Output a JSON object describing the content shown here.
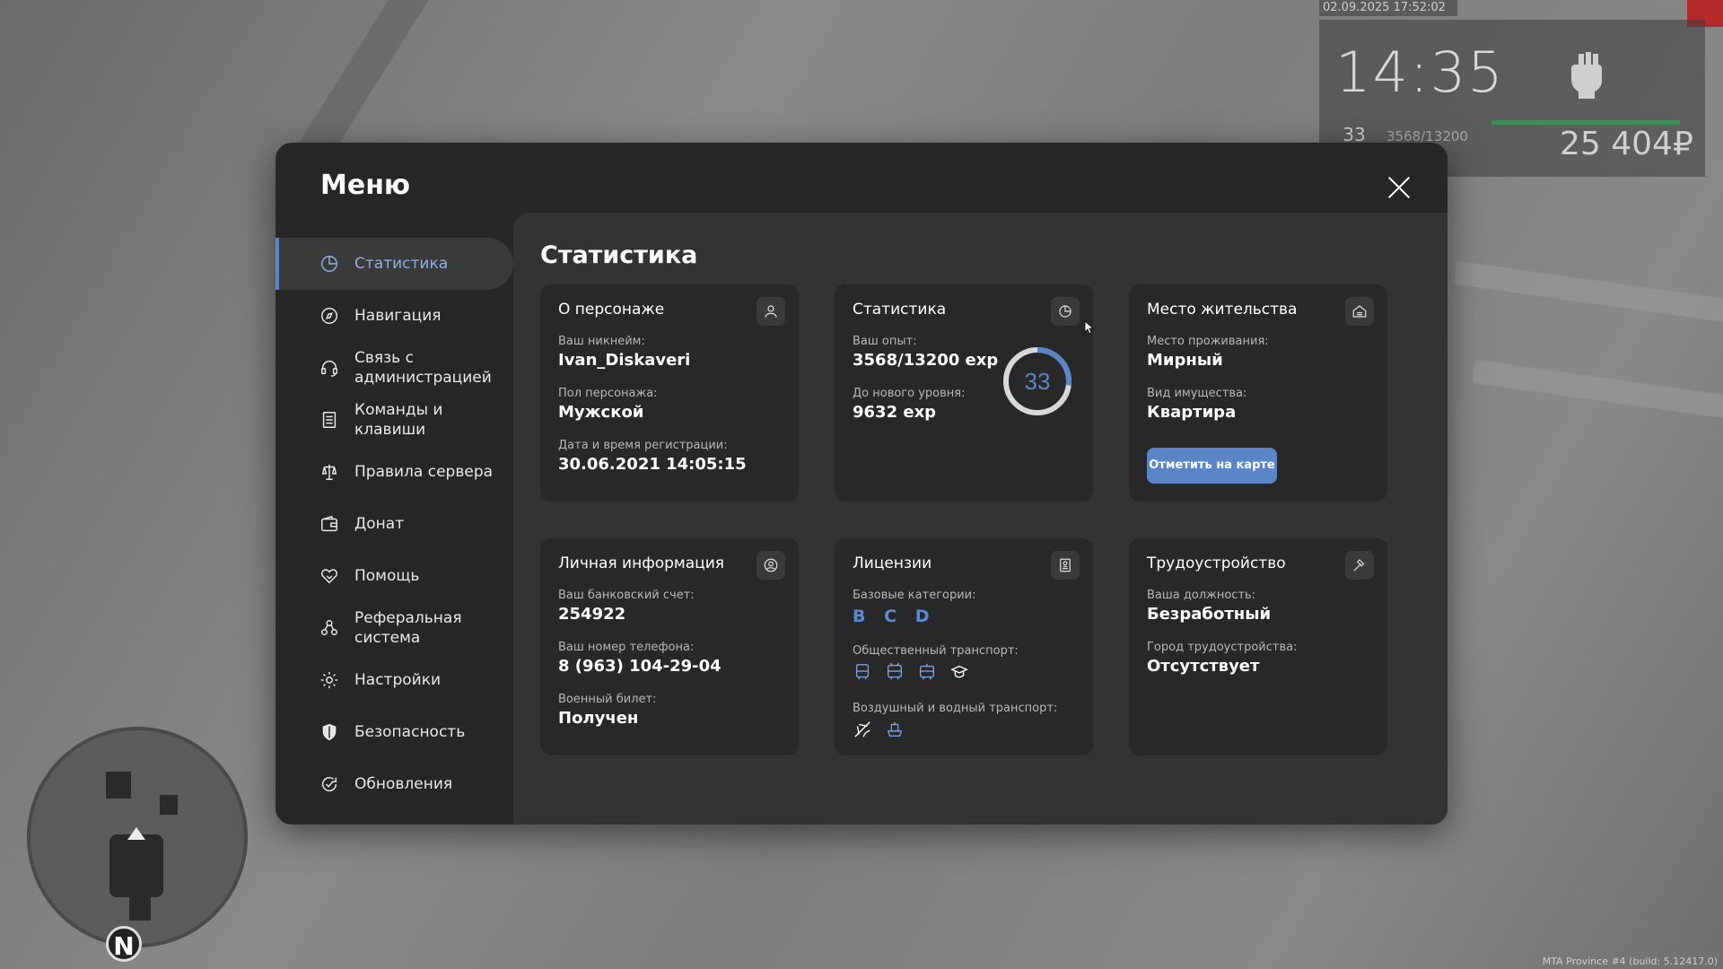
{
  "hud": {
    "datetime": "02.09.2025 17:52:02",
    "time": "14:35",
    "level": "33",
    "exp": "3568/13200",
    "money": "25 404₽"
  },
  "watermark": "MTA Province #4 (build: 5.12417.0)",
  "minimap": {
    "north": "N"
  },
  "menu": {
    "title": "Меню",
    "sidebar": [
      {
        "label": "Статистика",
        "icon": "pie-chart-icon",
        "active": true
      },
      {
        "label": "Навигация",
        "icon": "compass-icon"
      },
      {
        "label": "Связь с администрацией",
        "icon": "headset-icon"
      },
      {
        "label": "Команды и клавиши",
        "icon": "document-icon"
      },
      {
        "label": "Правила сервера",
        "icon": "scales-icon"
      },
      {
        "label": "Донат",
        "icon": "wallet-icon"
      },
      {
        "label": "Помощь",
        "icon": "handshake-icon"
      },
      {
        "label": "Реферальная система",
        "icon": "people-network-icon"
      },
      {
        "label": "Настройки",
        "icon": "gear-icon"
      },
      {
        "label": "Безопасность",
        "icon": "shield-icon"
      },
      {
        "label": "Обновления",
        "icon": "refresh-check-icon"
      }
    ]
  },
  "stats": {
    "title": "Статистика",
    "character": {
      "title": "О персонаже",
      "nick_label": "Ваш никнейм:",
      "nick": "Ivan_Diskaveri",
      "gender_label": "Пол персонажа:",
      "gender": "Мужской",
      "reg_label": "Дата и время регистрации:",
      "reg": "30.06.2021 14:05:15"
    },
    "statistics": {
      "title": "Статистика",
      "exp_label": "Ваш опыт:",
      "exp": "3568/13200 exp",
      "next_label": "До нового уровня:",
      "next": "9632 exp",
      "level": "33",
      "progress": 0.27
    },
    "residence": {
      "title": "Место жительства",
      "place_label": "Место проживания:",
      "place": "Мирный",
      "type_label": "Вид имущества:",
      "type": "Квартира",
      "button": "Отметить на карте"
    },
    "personal": {
      "title": "Личная информация",
      "bank_label": "Ваш банковский счет:",
      "bank": "254922",
      "phone_label": "Ваш номер телефона:",
      "phone": "8 (963) 104-29-04",
      "military_label": "Военный билет:",
      "military": "Получен"
    },
    "licenses": {
      "title": "Лицензии",
      "basic_label": "Базовые категории:",
      "categories": [
        "B",
        "C",
        "D"
      ],
      "public_label": "Общественный транспорт:",
      "air_label": "Воздушный и водный транспорт:"
    },
    "employment": {
      "title": "Трудоустройство",
      "position_label": "Ваша должность:",
      "position": "Безработный",
      "city_label": "Город трудоустройства:",
      "city": "Отсутствует"
    }
  },
  "colors": {
    "accent": "#5a86c8",
    "panel": "#262626",
    "card": "#282828"
  }
}
